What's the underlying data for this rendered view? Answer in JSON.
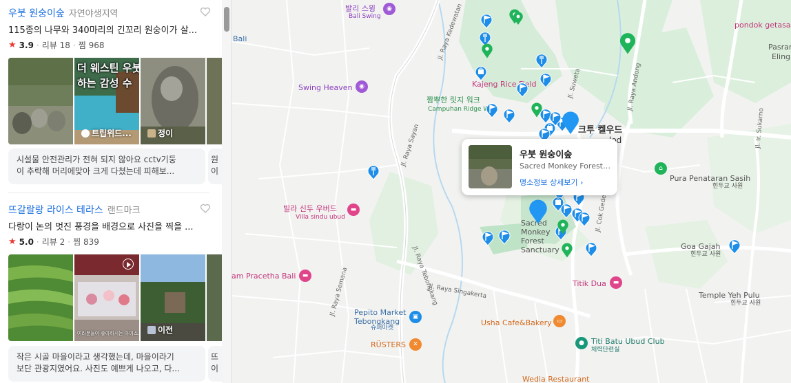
{
  "places": [
    {
      "name": "우붓 원숭이숲",
      "category": "자연야생지역",
      "description": "115종의 나무와 340마리의 긴꼬리 원숭이가 살...",
      "rating": "3.9",
      "reviews": "리뷰 18",
      "saves": "찜 968",
      "photo_labels": [
        "",
        "트립위드...",
        "정이"
      ],
      "photo_overlay": [
        "더 웨스틴 우붓",
        "하는 감성 수"
      ],
      "review_lines": [
        "시설물 안전관리가 전혀 되지 않아요 cctv기둥",
        "이 추락해 머리에맞아 크게 다쳤는데 피해보..."
      ],
      "review_partial": [
        "원",
        "이"
      ]
    },
    {
      "name": "뜨갈랄랑 라이스 테라스",
      "category": "랜드마크",
      "description": "다랑이 논의 멋진 풍경을 배경으로 사진을 찍을 ...",
      "rating": "5.0",
      "reviews": "리뷰 2",
      "saves": "찜 839",
      "photo_labels": [
        "",
        "",
        "이전"
      ],
      "photo_caption": "여러분들이 좋아하시는 아이스...",
      "review_lines": [
        "작은 시골 마을이라고 생각했는데, 마을이라기",
        "보단 관광지였어요. 사진도 예쁘게 나오고, 다..."
      ],
      "review_partial": [
        "뜨",
        "이"
      ]
    }
  ],
  "map": {
    "labels": {
      "bali_swing_ko": "발리 스윙",
      "bali_swing_en": "Bali Swing",
      "bali": "Bali",
      "swing_heaven": "Swing Heaven",
      "kajeng": "Kajeng Rice Field",
      "campuhan_ko": "짬뿌한 릿지 워크",
      "campuhan_en": "Campuhan Ridge Walk",
      "ketut_ko": "크투 켈우드",
      "ketut_en": "lod",
      "villa_ko": "빌라 신두 우버드",
      "villa_en": "Villa sindu ubud",
      "sacred_map": "Sacred Monkey Forest Sanctuary",
      "pracetha": "am Pracetha Bali",
      "pepito_en": "Pepito Market Tebongkang",
      "pepito_ko": "슈퍼마켓",
      "rusters": "RÜSTERS",
      "usha": "Usha Cafe&Bakery",
      "titi_batu_en": "Titi Batu Ubud Club",
      "titi_batu_ko": "체력단련실",
      "titik_dua": "Titik Dua",
      "wedia": "Wedia Restaurant",
      "pura_en": "Pura Penataran Sasih",
      "pura_ko": "힌두교 사원",
      "goa_gajah_en": "Goa Gajah",
      "goa_gajah_ko": "힌두교 사원",
      "temple_yeh_en": "Temple Yeh Pulu",
      "temple_yeh_ko": "힌두교 사원",
      "pondok": "pondok getasa",
      "pasrama": "Pasrama",
      "eling": "Eling",
      "roads": {
        "kedewatan": "Jl. Raya Kedewatan",
        "sayan": "Jl. Raya Sayan",
        "suweta": "Jl. Suweta",
        "andong": "Jl. Raya Andong",
        "sukarno": "Jl. Ir. Sukarno",
        "semana": "Jl. Raya Semana",
        "tebongkang": "Jl. Raya Tebongkang",
        "singakerta": "Jl. Raya Singakerta",
        "cok_gede": "Jl. Cok Gede",
        "raya_ubud": "Jl. Raya"
      }
    },
    "popup": {
      "title": "우붓 원숭이숲",
      "subtitle": "Sacred Monkey Forest S...",
      "link": "명소정보 상세보기"
    },
    "colors": {
      "marker_blue": "#1e8de8",
      "marker_green": "#1fb35a",
      "park_green": "#cfead5",
      "accent_link": "#1a6fe0"
    }
  }
}
